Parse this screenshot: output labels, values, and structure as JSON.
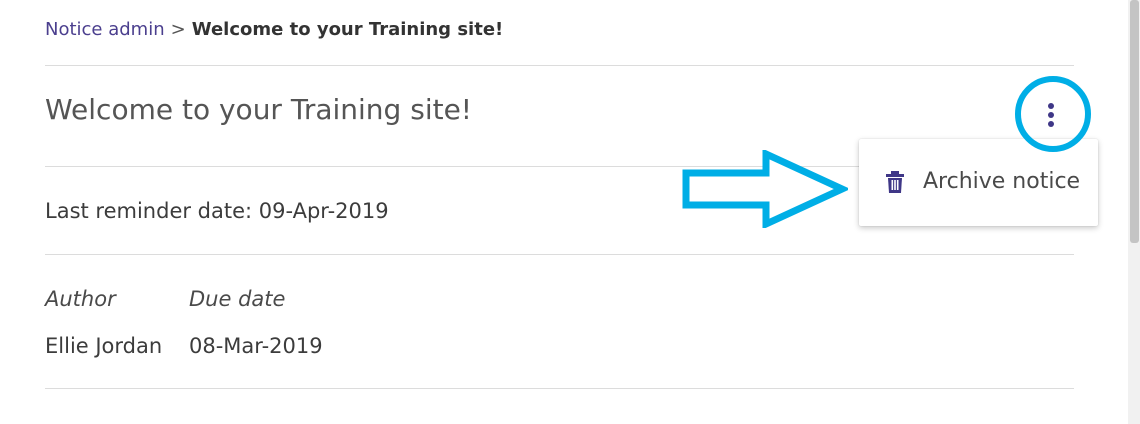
{
  "breadcrumb": {
    "parent_label": "Notice admin",
    "separator": ">",
    "current_label": "Welcome to your Training site!"
  },
  "notice": {
    "title": "Welcome to your Training site!",
    "reminder_text": "Last reminder date: 09-Apr-2019",
    "table": {
      "columns": [
        "Author",
        "Due date"
      ],
      "values": [
        "Ellie Jordan",
        "08-Mar-2019"
      ]
    }
  },
  "actions_menu": {
    "trigger_icon": "kebab-vertical-icon",
    "items": [
      {
        "label": "Archive notice",
        "icon": "trash-icon"
      }
    ]
  },
  "annotation": {
    "highlight_color": "#00aee6"
  },
  "colors": {
    "link": "#4b3f8e",
    "icon": "#3f3787",
    "text": "#3c3c3c",
    "divider": "#dcdcdc"
  }
}
